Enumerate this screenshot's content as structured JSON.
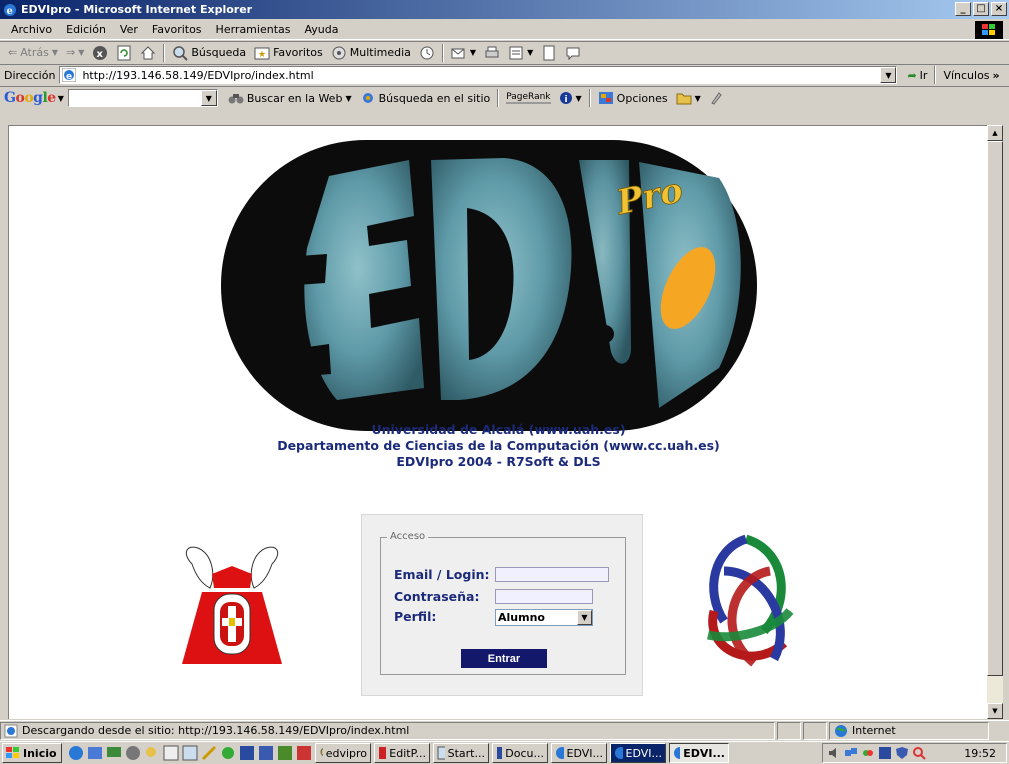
{
  "window": {
    "title": "EDVIpro - Microsoft Internet Explorer",
    "controls": [
      "_",
      "□",
      "×"
    ]
  },
  "menu": [
    "Archivo",
    "Edición",
    "Ver",
    "Favoritos",
    "Herramientas",
    "Ayuda"
  ],
  "toolbar": {
    "back": "Atrás",
    "search": "Búsqueda",
    "favorites": "Favoritos",
    "multimedia": "Multimedia"
  },
  "address": {
    "label": "Dirección",
    "url": "http://193.146.58.149/EDVIpro/index.html",
    "go": "Ir",
    "links": "Vínculos"
  },
  "googlebar": {
    "logo": "Google",
    "search_web": "Buscar en la Web",
    "search_site": "Búsqueda en el sitio",
    "pagerank": "PageRank",
    "options": "Opciones"
  },
  "page": {
    "logo_text": "Pro",
    "info": [
      "Universidad de Alcalá (www.uah.es)",
      "Departamento de Ciencias de la Computación (www.cc.uah.es)",
      "EDVIpro 2004 - R7Soft & DLS"
    ],
    "login": {
      "legend": "Acceso",
      "email_label": "Email / Login:",
      "password_label": "Contraseña:",
      "profile_label": "Perfil:",
      "profile_value": "Alumno",
      "submit": "Entrar"
    },
    "colors": {
      "text_navy": "#1b2a7a",
      "button_bg": "#14186a",
      "logo_orange": "#f5a623",
      "logo_teal": "#5f9aa8"
    }
  },
  "status": {
    "text": "Descargando desde el sitio: http://193.146.58.149/EDVIpro/index.html",
    "zone": "Internet"
  },
  "taskbar": {
    "start": "Inicio",
    "tasks": [
      "edvipro",
      "EditP...",
      "Start...",
      "Docu...",
      "EDVI...",
      "EDVI...",
      "EDVI..."
    ],
    "active_index": 6,
    "clock": "19:52"
  }
}
